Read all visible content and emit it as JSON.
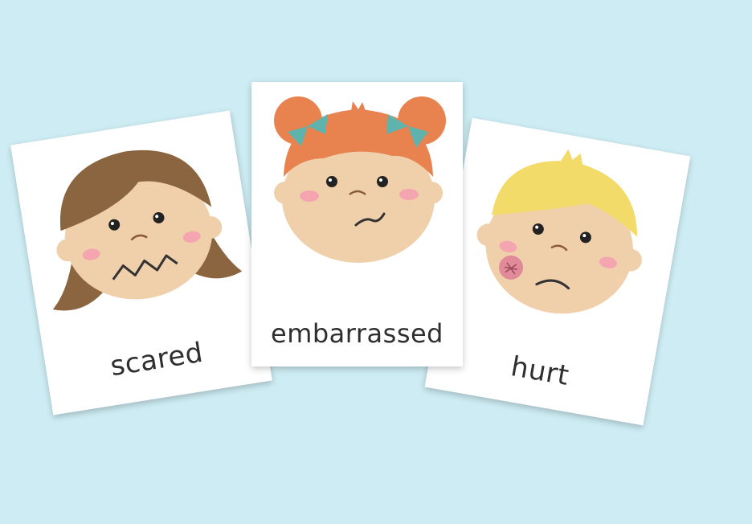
{
  "cards": [
    {
      "label": "scared",
      "face": "girl-brown-hair-scared"
    },
    {
      "label": "embarrassed",
      "face": "girl-red-pigtails-embarrassed"
    },
    {
      "label": "hurt",
      "face": "boy-blond-hair-hurt"
    }
  ],
  "colors": {
    "background": "#cdecf3",
    "card": "#ffffff",
    "skin": "#f0cfab",
    "cheek": "#f4a5b0",
    "brown_hair": "#8b6440",
    "red_hair": "#e8824f",
    "blond_hair": "#f3db6a",
    "bow": "#5fb3ad",
    "text": "#2f2f2f"
  }
}
